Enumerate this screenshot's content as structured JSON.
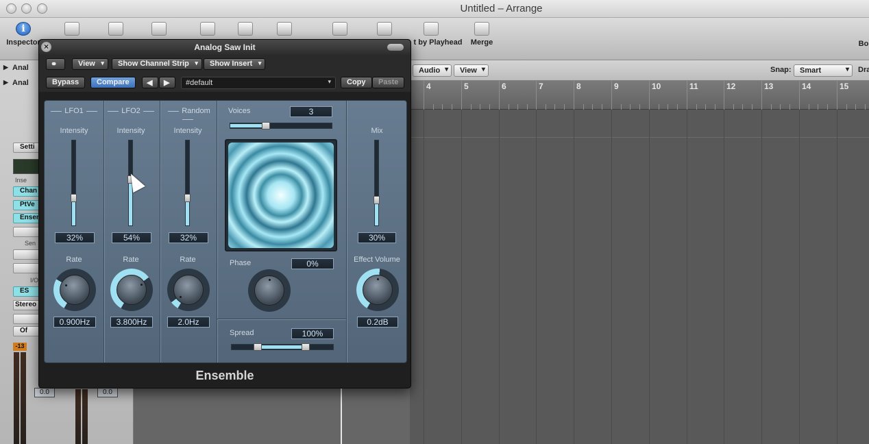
{
  "window": {
    "title": "Untitled – Arrange"
  },
  "toolbar": {
    "inspector_label": "Inspector",
    "split_label": "t by Playhead",
    "merge_label": "Merge",
    "right_cut_label": "Bo"
  },
  "subbar": {
    "audio_menu": "Audio",
    "view_menu": "View",
    "snap_label": "Snap:",
    "snap_value": "Smart",
    "drag_cut": "Dra"
  },
  "tracks": {
    "header1": "Anal",
    "header2": "Anal"
  },
  "inspector": {
    "setting_btn": "Setti",
    "insert_label": "Inse",
    "slots": [
      "Chan",
      "PtVe",
      "Ensem"
    ],
    "sends_label": "Sen",
    "io_label": "I/O",
    "io_slot": "ES",
    "stereo_slot": "Stereo",
    "off_slot": "Of",
    "level_badge": "-13",
    "vol1": "0.0",
    "vol2": "0.0"
  },
  "ruler": {
    "bars": [
      "4",
      "5",
      "6",
      "7",
      "8",
      "9",
      "10",
      "11",
      "12",
      "13",
      "14",
      "15"
    ]
  },
  "plugin": {
    "title": "Analog Saw Init",
    "view_menu": "View",
    "channel_strip_menu": "Show Channel Strip",
    "insert_menu": "Show Insert",
    "bypass": "Bypass",
    "compare": "Compare",
    "preset": "#default",
    "copy": "Copy",
    "paste": "Paste",
    "name": "Ensemble",
    "lfo1": {
      "head": "LFO1",
      "intensity_label": "Intensity",
      "intensity": "32%",
      "intensity_frac": 0.32,
      "rate_label": "Rate",
      "rate": "0.900Hz",
      "rate_frac": 0.3
    },
    "lfo2": {
      "head": "LFO2",
      "intensity_label": "Intensity",
      "intensity": "54%",
      "intensity_frac": 0.54,
      "rate_label": "Rate",
      "rate": "3.800Hz",
      "rate_frac": 0.68
    },
    "random": {
      "head": "Random",
      "intensity_label": "Intensity",
      "intensity": "32%",
      "intensity_frac": 0.32,
      "rate_label": "Rate",
      "rate": "2.0Hz",
      "rate_frac": 0.08
    },
    "voices": {
      "label": "Voices",
      "value": "3",
      "frac": 0.35
    },
    "phase": {
      "label": "Phase",
      "value": "0%"
    },
    "spread": {
      "label": "Spread",
      "value": "100%"
    },
    "mix": {
      "label": "Mix",
      "value": "30%",
      "frac": 0.3
    },
    "effect_volume": {
      "label": "Effect Volume",
      "value": "0.2dB",
      "frac": 0.52
    }
  },
  "colors": {
    "accent": "#9fe0f2",
    "panel": "#5f7386",
    "compare_on": "#4f84c9"
  }
}
